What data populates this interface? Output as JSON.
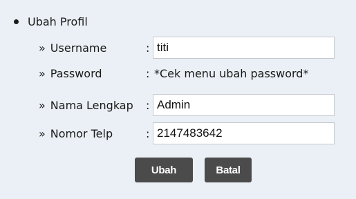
{
  "section": {
    "title": "Ubah Profil"
  },
  "fields": {
    "username": {
      "label": "Username",
      "value": "titi"
    },
    "password": {
      "label": "Password",
      "note": "*Cek menu ubah password*"
    },
    "nama_lengkap": {
      "label": "Nama Lengkap",
      "value": "Admin"
    },
    "nomor_telp": {
      "label": "Nomor Telp",
      "value": "2147483642"
    }
  },
  "common": {
    "bullet_prefix": "»",
    "separator": ":"
  },
  "buttons": {
    "submit_label": "Ubah",
    "cancel_label": "Batal"
  },
  "colors": {
    "panel_background": "#eaf0f5",
    "button_background": "#4b4b4b",
    "button_text": "#ffffff"
  }
}
